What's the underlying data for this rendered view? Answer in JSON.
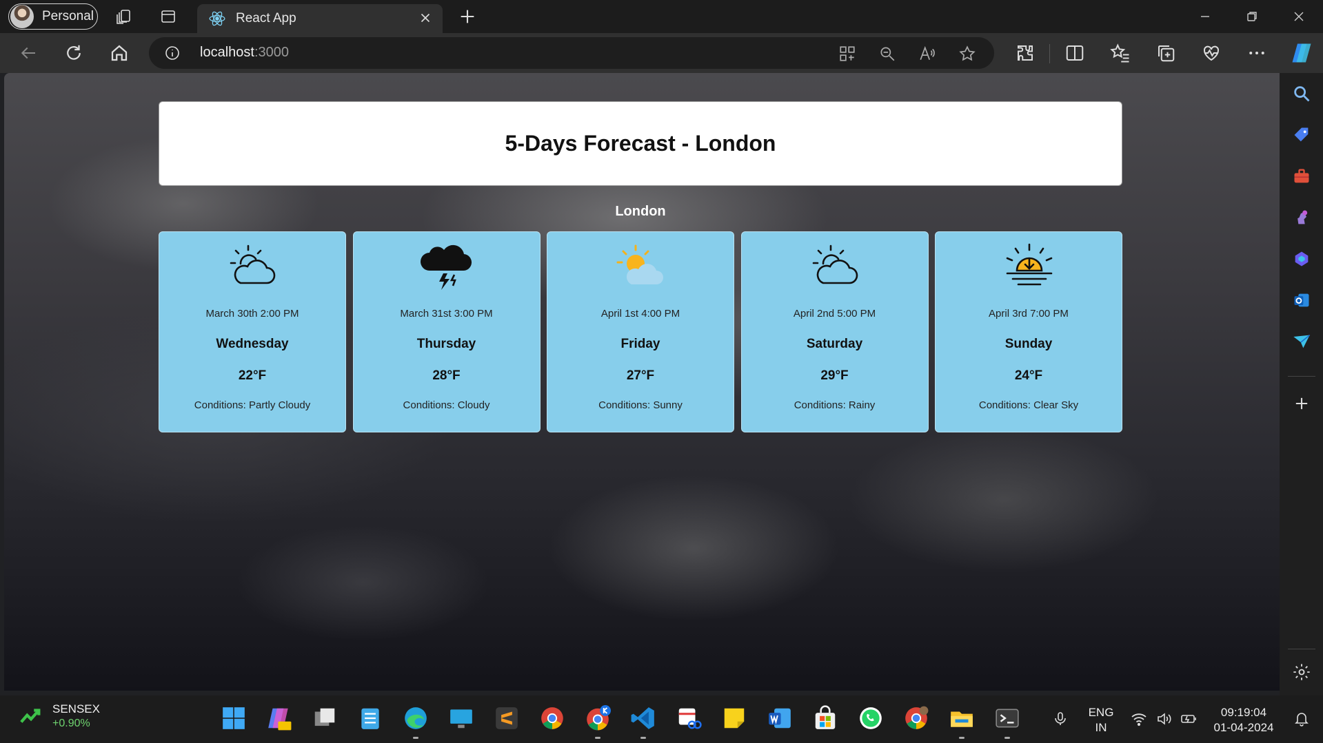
{
  "browser": {
    "profile_label": "Personal",
    "tab_title": "React App",
    "url_host": "localhost",
    "url_port": ":3000"
  },
  "page": {
    "heading": "5-Days Forecast - London",
    "city": "London",
    "forecast": [
      {
        "date": "March 30th 2:00 PM",
        "day": "Wednesday",
        "temp": "22°F",
        "conditions": "Conditions: Partly Cloudy",
        "icon": "partly-cloudy-icon"
      },
      {
        "date": "March 31st 3:00 PM",
        "day": "Thursday",
        "temp": "28°F",
        "conditions": "Conditions: Cloudy",
        "icon": "thunderstorm-icon"
      },
      {
        "date": "April 1st 4:00 PM",
        "day": "Friday",
        "temp": "27°F",
        "conditions": "Conditions: Sunny",
        "icon": "sun-behind-cloud-icon"
      },
      {
        "date": "April 2nd 5:00 PM",
        "day": "Saturday",
        "temp": "29°F",
        "conditions": "Conditions: Rainy",
        "icon": "partly-cloudy-icon"
      },
      {
        "date": "April 3rd 7:00 PM",
        "day": "Sunday",
        "temp": "24°F",
        "conditions": "Conditions: Clear Sky",
        "icon": "sunset-icon"
      }
    ]
  },
  "taskbar": {
    "stock_name": "SENSEX",
    "stock_change": "+0.90%",
    "lang_line1": "ENG",
    "lang_line2": "IN",
    "time": "09:19:04",
    "date": "01-04-2024"
  },
  "colors": {
    "card_bg": "#87ceeb",
    "header_bg": "#ffffff",
    "stock_up": "#6fd36f"
  }
}
